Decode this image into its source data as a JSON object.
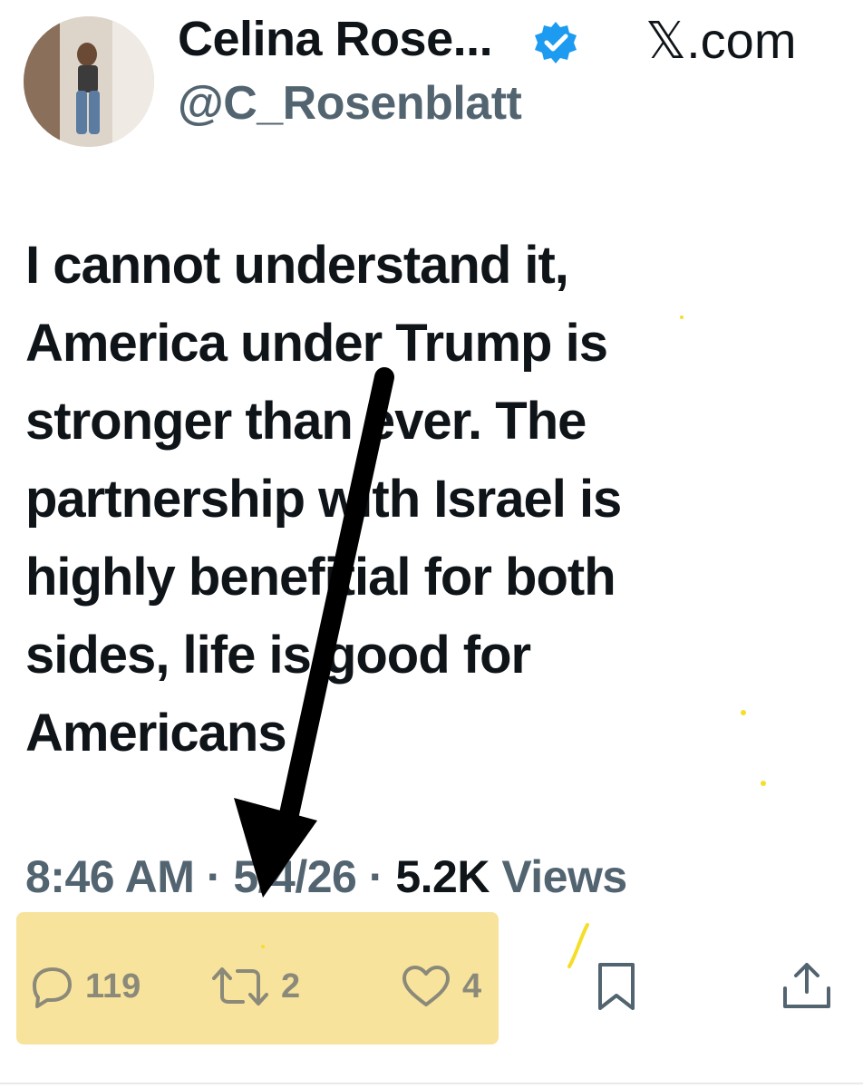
{
  "author": {
    "display_name": "Celina Rose...",
    "handle": "@C_Rosenblatt",
    "verified_icon": "verified-badge-icon",
    "avatar_icon": "avatar-photo"
  },
  "brand": "𝕏.com",
  "tweet": {
    "lines": [
      "I cannot understand it,",
      "America under Trump is",
      "stronger than ever. The",
      "partnership with Israel is",
      "highly benefitial for both",
      "sides, life is good for",
      "Americans"
    ]
  },
  "meta": {
    "time": "8:46 AM",
    "separator": "·",
    "date": "5/4/26",
    "views_count": "5.2K",
    "views_label": "Views"
  },
  "actions": {
    "reply": {
      "icon": "reply-icon",
      "count": "119"
    },
    "retweet": {
      "icon": "retweet-icon",
      "count": "2"
    },
    "like": {
      "icon": "heart-icon",
      "count": "4"
    },
    "bookmark": {
      "icon": "bookmark-icon"
    },
    "share": {
      "icon": "share-icon"
    }
  },
  "annotations": {
    "highlight_color": "#f8e39c",
    "arrow_color": "#000000"
  }
}
